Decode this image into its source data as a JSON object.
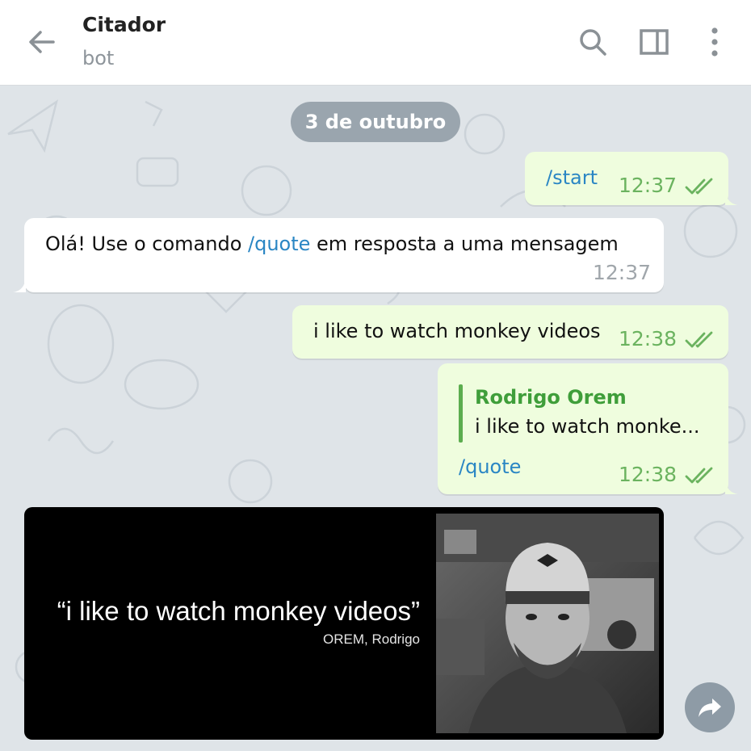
{
  "chat": {
    "title": "Citador",
    "subtitle": "bot"
  },
  "header_icons": [
    "back-arrow-icon",
    "search-icon",
    "sidebar-toggle-icon",
    "more-vertical-icon"
  ],
  "date_separator": "3 de outubro",
  "messages": [
    {
      "direction": "out",
      "text": "/start",
      "time": "12:37",
      "status": "read"
    },
    {
      "direction": "in",
      "text_before": "Olá! Use o comando ",
      "command": "/quote",
      "text_after": " em resposta a uma mensagem",
      "time": "12:37"
    },
    {
      "direction": "out",
      "text": "i like to watch monkey videos",
      "time": "12:38",
      "status": "read"
    },
    {
      "direction": "out",
      "reply_name": "Rodrigo Orem",
      "reply_text": "i like to watch monke...",
      "text": "/quote",
      "time": "12:38",
      "status": "read"
    }
  ],
  "quote_card": {
    "quote": "“i like to watch monkey videos”",
    "author": "OREM, Rodrigo"
  },
  "colors": {
    "header_bg": "#ffffff",
    "chat_bg": "#dfe4e8",
    "outgoing_bubble": "#effdde",
    "incoming_bubble": "#ffffff",
    "link": "#2a86c4",
    "time_out": "#6bb35f",
    "reply_name": "#3f9e3a"
  }
}
